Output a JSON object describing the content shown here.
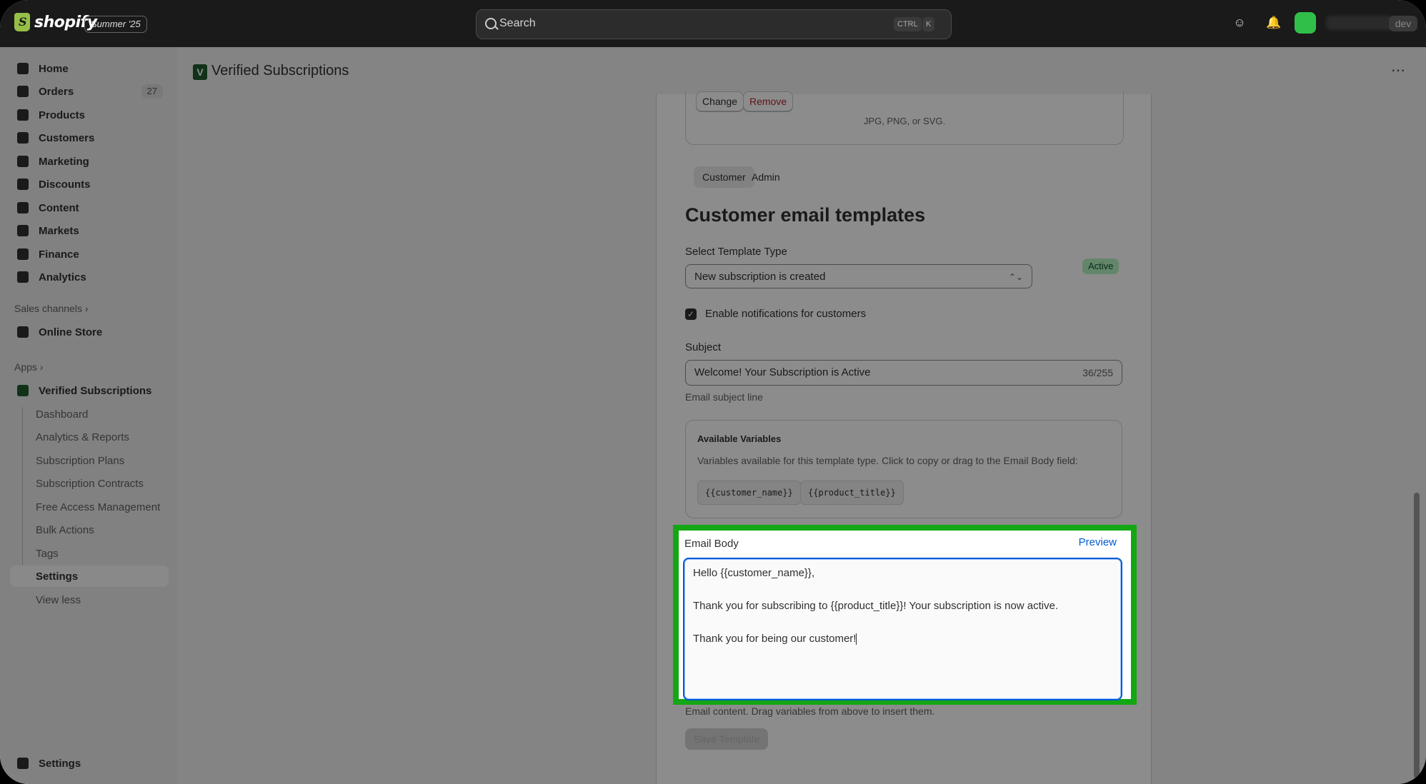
{
  "topbar": {
    "brand": "shopify",
    "edition": "Summer '25",
    "search_placeholder": "Search",
    "kbd_ctrl": "CTRL",
    "kbd_k": "K",
    "store_badge": "dev"
  },
  "sidebar": {
    "items": [
      {
        "label": "Home"
      },
      {
        "label": "Orders",
        "count": "27"
      },
      {
        "label": "Products"
      },
      {
        "label": "Customers"
      },
      {
        "label": "Marketing"
      },
      {
        "label": "Discounts"
      },
      {
        "label": "Content"
      },
      {
        "label": "Markets"
      },
      {
        "label": "Finance"
      },
      {
        "label": "Analytics"
      }
    ],
    "sales_channels_label": "Sales channels",
    "online_store": "Online Store",
    "apps_label": "Apps",
    "app_name": "Verified Subscriptions",
    "app_subitems": [
      "Dashboard",
      "Analytics & Reports",
      "Subscription Plans",
      "Subscription Contracts",
      "Free Access Management",
      "Bulk Actions",
      "Tags",
      "Settings",
      "View less"
    ],
    "footer_settings": "Settings"
  },
  "header": {
    "title": "Verified Subscriptions",
    "more": "⋯"
  },
  "upload": {
    "change": "Change",
    "remove": "Remove",
    "hint": "JPG, PNG, or SVG."
  },
  "tabs": [
    "Customer",
    "Admin"
  ],
  "templates": {
    "title": "Customer email templates",
    "select_label": "Select Template Type",
    "select_value": "New subscription is created",
    "status": "Active",
    "enable_label": "Enable notifications for customers",
    "subject_label": "Subject",
    "subject_value": "Welcome! Your Subscription is Active",
    "subject_counter": "36/255",
    "subject_help": "Email subject line",
    "vars_title": "Available Variables",
    "vars_desc": "Variables available for this template type. Click to copy or drag to the Email Body field:",
    "vars": [
      "{{customer_name}}",
      "{{product_title}}"
    ],
    "body_label": "Email Body",
    "preview": "Preview",
    "body_lines": [
      "Hello {{customer_name}},",
      "Thank you for subscribing to {{product_title}}! Your subscription is now active.",
      "Thank you for being our customer!"
    ],
    "body_help": "Email content. Drag variables from above to insert them.",
    "save": "Save Template"
  },
  "colors": {
    "highlight": "#13a713",
    "link": "#005bd3",
    "active_badge": "#b4f5c2"
  }
}
